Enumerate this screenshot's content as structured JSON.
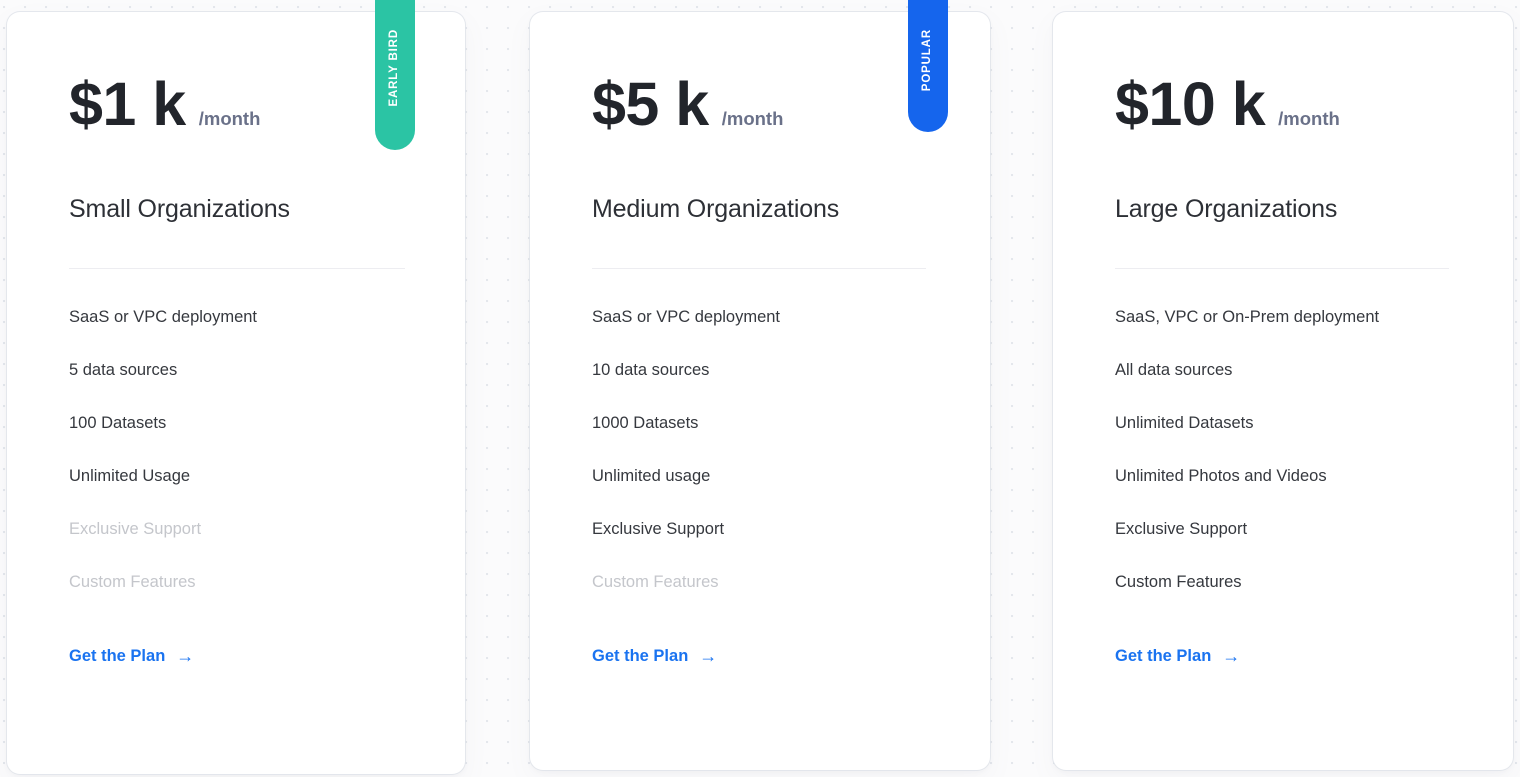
{
  "page": {
    "background_color": "#fbfbfc",
    "dot_grid_color": "#e4e7ec"
  },
  "plans": [
    {
      "badge": {
        "label": "EARLY BIRD",
        "color": "#2bc4a4"
      },
      "price_amount": "$1 k",
      "price_period": "/month",
      "plan_name": "Small Organizations",
      "features": [
        {
          "label": "SaaS or VPC deployment",
          "included": true
        },
        {
          "label": "5 data sources",
          "included": true
        },
        {
          "label": "100 Datasets",
          "included": true
        },
        {
          "label": "Unlimited Usage",
          "included": true
        },
        {
          "label": "Exclusive Support",
          "included": false
        },
        {
          "label": "Custom Features",
          "included": false
        }
      ],
      "cta": {
        "label": "Get the Plan",
        "arrow": "→",
        "color": "#1a73f0"
      }
    },
    {
      "badge": {
        "label": "POPULAR",
        "color": "#1565ed"
      },
      "price_amount": "$5 k",
      "price_period": "/month",
      "plan_name": "Medium Organizations",
      "features": [
        {
          "label": "SaaS or VPC deployment",
          "included": true
        },
        {
          "label": "10 data sources",
          "included": true
        },
        {
          "label": "1000 Datasets",
          "included": true
        },
        {
          "label": "Unlimited usage",
          "included": true
        },
        {
          "label": "Exclusive Support",
          "included": true
        },
        {
          "label": "Custom Features",
          "included": false
        }
      ],
      "cta": {
        "label": "Get the Plan",
        "arrow": "→",
        "color": "#1a73f0"
      }
    },
    {
      "badge": null,
      "price_amount": "$10 k",
      "price_period": "/month",
      "plan_name": "Large Organizations",
      "features": [
        {
          "label": "SaaS, VPC or On-Prem deployment",
          "included": true
        },
        {
          "label": "All data sources",
          "included": true
        },
        {
          "label": "Unlimited Datasets",
          "included": true
        },
        {
          "label": "Unlimited Photos and Videos",
          "included": true
        },
        {
          "label": "Exclusive Support",
          "included": true
        },
        {
          "label": "Custom Features",
          "included": true
        }
      ],
      "cta": {
        "label": "Get the Plan",
        "arrow": "→",
        "color": "#1a73f0"
      }
    }
  ]
}
